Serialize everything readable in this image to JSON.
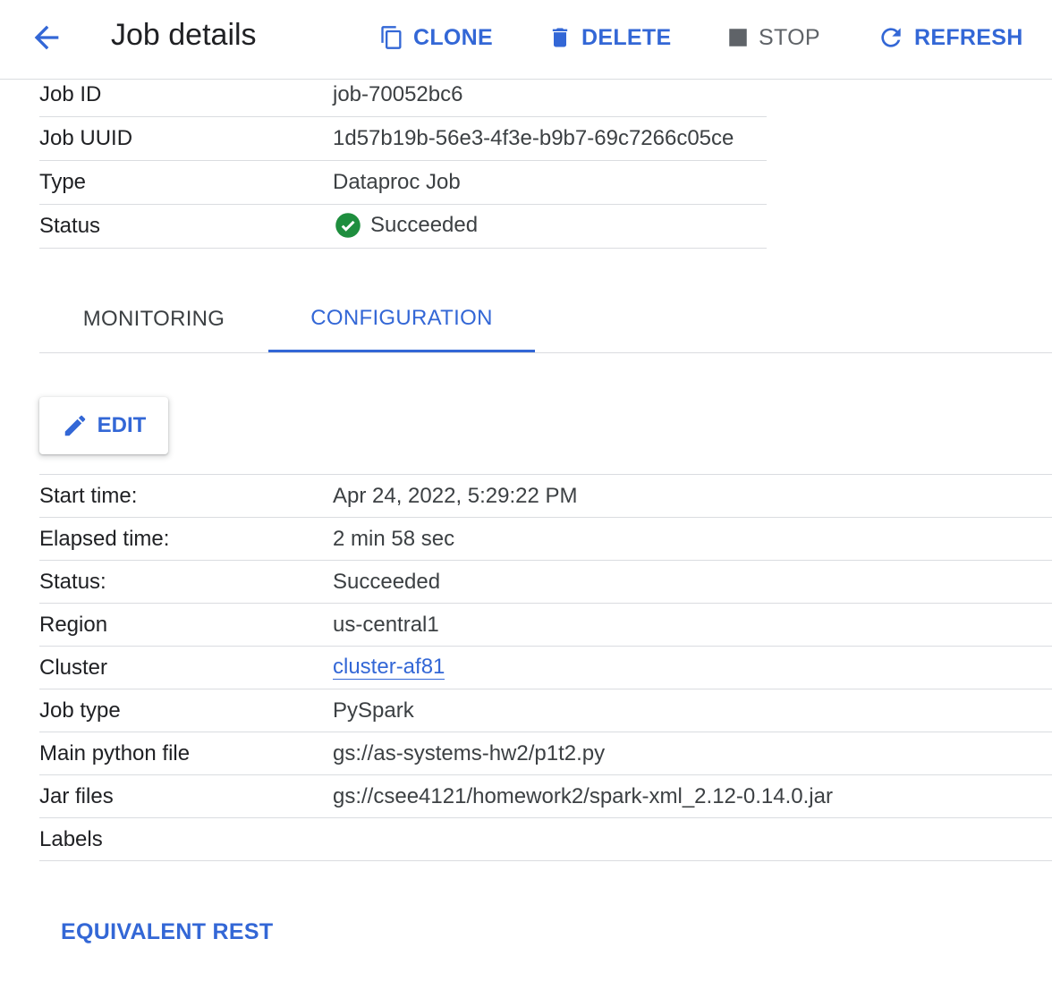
{
  "header": {
    "title": "Job details",
    "actions": {
      "clone": "CLONE",
      "delete": "DELETE",
      "stop": "STOP",
      "refresh": "REFRESH"
    }
  },
  "summary": [
    {
      "key": "Job ID",
      "value": "job-70052bc6"
    },
    {
      "key": "Job UUID",
      "value": "1d57b19b-56e3-4f3e-b9b7-69c7266c05ce"
    },
    {
      "key": "Type",
      "value": "Dataproc Job"
    },
    {
      "key": "Status",
      "value": "Succeeded"
    }
  ],
  "tabs": [
    {
      "label": "MONITORING",
      "active": false
    },
    {
      "label": "CONFIGURATION",
      "active": true
    }
  ],
  "edit_label": "EDIT",
  "config": [
    {
      "key": "Start time:",
      "value": "Apr 24, 2022, 5:29:22 PM"
    },
    {
      "key": "Elapsed time:",
      "value": "2 min 58 sec"
    },
    {
      "key": "Status:",
      "value": "Succeeded"
    },
    {
      "key": "Region",
      "value": "us-central1"
    },
    {
      "key": "Cluster",
      "value": "cluster-af81"
    },
    {
      "key": "Job type",
      "value": "PySpark"
    },
    {
      "key": "Main python file",
      "value": "gs://as-systems-hw2/p1t2.py"
    },
    {
      "key": "Jar files",
      "value": "gs://csee4121/homework2/spark-xml_2.12-0.14.0.jar"
    },
    {
      "key": "Labels",
      "value": ""
    }
  ],
  "equivalent_rest": "EQUIVALENT REST",
  "colors": {
    "accent": "#3367d6",
    "success": "#1e8e3e",
    "divider": "#dadce0"
  },
  "icons": {
    "back": "arrow-back-icon",
    "clone": "copy-icon",
    "delete": "trash-icon",
    "stop": "stop-icon",
    "refresh": "refresh-icon",
    "status": "check-circle-icon",
    "edit": "pencil-icon"
  }
}
